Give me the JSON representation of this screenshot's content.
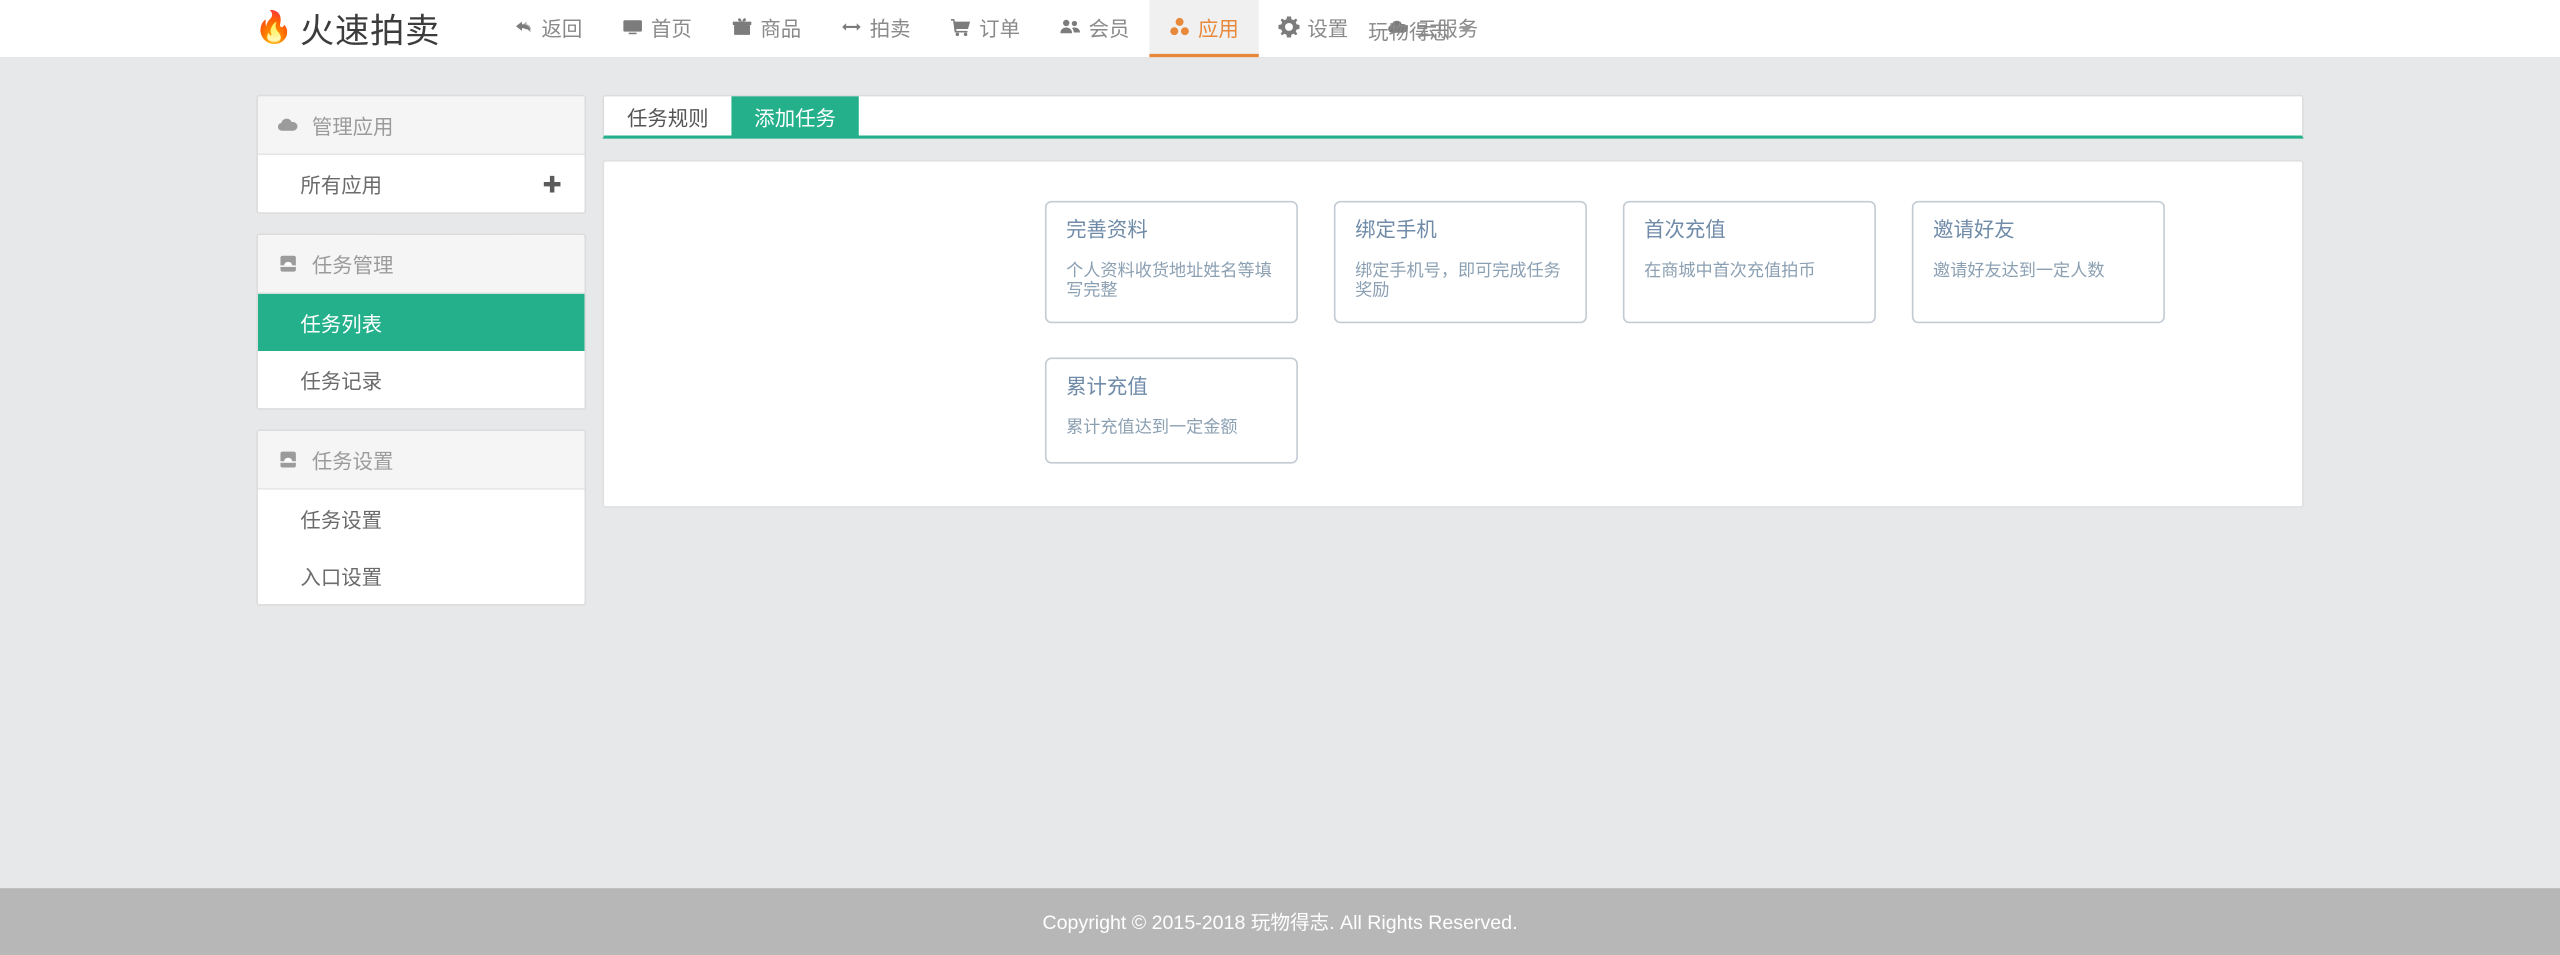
{
  "header": {
    "brand": {
      "logo_icon": "flame-icon",
      "logo_glyph": "🔥",
      "name": "火速拍卖"
    },
    "nav": [
      {
        "label": "返回",
        "icon": "back-arrow-icon",
        "active": false
      },
      {
        "label": "首页",
        "icon": "monitor-icon",
        "active": false
      },
      {
        "label": "商品",
        "icon": "gift-icon",
        "active": false
      },
      {
        "label": "拍卖",
        "icon": "arrows-icon",
        "active": false
      },
      {
        "label": "订单",
        "icon": "cart-icon",
        "active": false
      },
      {
        "label": "会员",
        "icon": "users-icon",
        "active": false
      },
      {
        "label": "应用",
        "icon": "apps-cubes-icon",
        "active": true
      },
      {
        "label": "设置",
        "icon": "gear-icon",
        "active": false
      },
      {
        "label": "云服务",
        "icon": "cloud-icon",
        "active": false
      }
    ],
    "user": {
      "name": "玩物得志",
      "caret_icon": "chevron-down-icon"
    },
    "accent_active": "#e8883a"
  },
  "sidebar": {
    "groups": [
      {
        "title": "管理应用",
        "icon": "cloud-icon",
        "items": [
          {
            "label": "所有应用",
            "active": false,
            "action_icon": "plus-icon",
            "action_glyph": "✚"
          }
        ]
      },
      {
        "title": "任务管理",
        "icon": "inbox-icon",
        "items": [
          {
            "label": "任务列表",
            "active": true
          },
          {
            "label": "任务记录",
            "active": false
          }
        ]
      },
      {
        "title": "任务设置",
        "icon": "inbox-icon",
        "items": [
          {
            "label": "任务设置",
            "active": false
          },
          {
            "label": "入口设置",
            "active": false
          }
        ]
      }
    ],
    "active_color": "#24b08b"
  },
  "content": {
    "tabs": [
      {
        "label": "任务规则",
        "active": false
      },
      {
        "label": "添加任务",
        "active": true
      }
    ],
    "tab_accent": "#24b08b",
    "task_cards": [
      {
        "title": "完善资料",
        "desc": "个人资料收货地址姓名等填写完整"
      },
      {
        "title": "绑定手机",
        "desc": "绑定手机号，即可完成任务奖励"
      },
      {
        "title": "首次充值",
        "desc": "在商城中首次充值拍币"
      },
      {
        "title": "邀请好友",
        "desc": "邀请好友达到一定人数"
      },
      {
        "title": "累计充值",
        "desc": "累计充值达到一定金额"
      }
    ]
  },
  "footer": {
    "text": "Copyright © 2015-2018 玩物得志. All Rights Reserved."
  }
}
